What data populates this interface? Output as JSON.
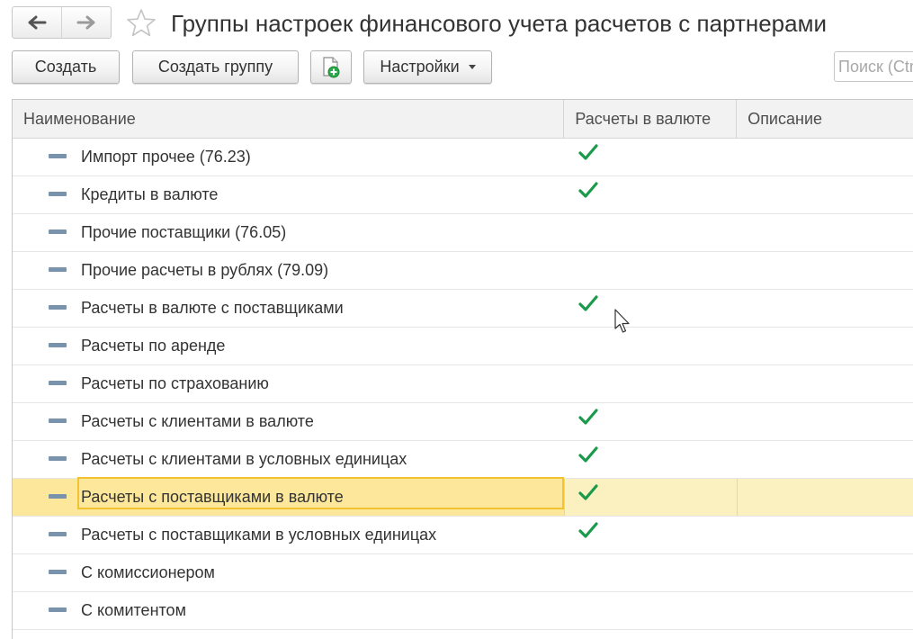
{
  "header": {
    "title": "Группы настроек финансового учета расчетов с партнерами",
    "back_icon": "arrow-left-icon",
    "forward_icon": "arrow-right-icon",
    "favorite_icon": "star-outline-icon"
  },
  "toolbar": {
    "create_label": "Создать",
    "create_group_label": "Создать группу",
    "add_file_icon": "document-add-icon",
    "settings_label": "Настройки",
    "search_placeholder": "Поиск (Ctrl+F)"
  },
  "table": {
    "columns": [
      "Наименование",
      "Расчеты в валюте",
      "Описание"
    ],
    "rows": [
      {
        "name": "Импорт прочее (76.23)",
        "currency": true,
        "description": ""
      },
      {
        "name": "Кредиты в валюте",
        "currency": true,
        "description": ""
      },
      {
        "name": "Прочие поставщики (76.05)",
        "currency": false,
        "description": ""
      },
      {
        "name": "Прочие расчеты в рублях (79.09)",
        "currency": false,
        "description": ""
      },
      {
        "name": "Расчеты в валюте с поставщиками",
        "currency": true,
        "description": ""
      },
      {
        "name": "Расчеты по аренде",
        "currency": false,
        "description": ""
      },
      {
        "name": "Расчеты по страхованию",
        "currency": false,
        "description": ""
      },
      {
        "name": "Расчеты с клиентами в валюте",
        "currency": true,
        "description": ""
      },
      {
        "name": "Расчеты с клиентами в условных единицах",
        "currency": true,
        "description": ""
      },
      {
        "name": "Расчеты с поставщиками в валюте",
        "currency": true,
        "description": "",
        "selected": true
      },
      {
        "name": "Расчеты с поставщиками в условных единицах",
        "currency": true,
        "description": ""
      },
      {
        "name": "С комиссионером",
        "currency": false,
        "description": ""
      },
      {
        "name": "С комитентом",
        "currency": false,
        "description": ""
      }
    ]
  },
  "colors": {
    "check": "#1a9a4a",
    "selected_row": "#fbf0c0",
    "selected_cell": "#fce79a",
    "focus_border": "#f2c230",
    "item_marker": "#7a93ad"
  }
}
